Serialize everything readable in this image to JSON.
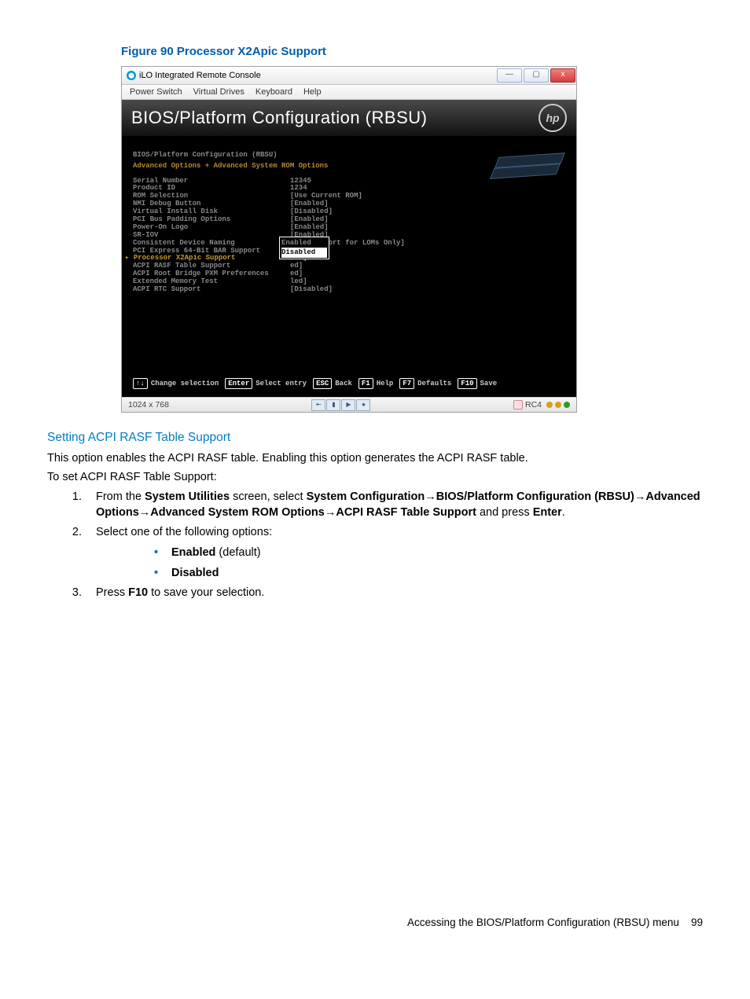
{
  "figure_caption": "Figure 90 Processor X2Apic Support",
  "window": {
    "title": "iLO Integrated Remote Console",
    "menu": [
      "Power Switch",
      "Virtual Drives",
      "Keyboard",
      "Help"
    ],
    "win_min": "—",
    "win_max": "▢",
    "win_close": "x"
  },
  "bios": {
    "heading": "BIOS/Platform Configuration (RBSU)",
    "logo": "hp",
    "breadcrumb1": "BIOS/Platform Configuration (RBSU)",
    "breadcrumb2": "Advanced Options + Advanced System ROM Options",
    "rows": [
      {
        "label": "Serial Number",
        "value": "12345"
      },
      {
        "label": "Product ID",
        "value": "1234"
      },
      {
        "label": "ROM Selection",
        "value": "[Use Current ROM]"
      },
      {
        "label": "NMI Debug Button",
        "value": "[Enabled]"
      },
      {
        "label": "Virtual Install Disk",
        "value": "[Disabled]"
      },
      {
        "label": "PCI Bus Padding Options",
        "value": "[Enabled]"
      },
      {
        "label": "Power-On Logo",
        "value": "[Enabled]"
      },
      {
        "label": "SR-IOV",
        "value": "[Enabled]"
      },
      {
        "label": "Consistent Device Naming",
        "value": "[CDN Support for LOMs Only]"
      },
      {
        "label": "PCI Express 64-Bit BAR Support",
        "value": "[Enabled]"
      },
      {
        "label": "Processor X2Apic Support",
        "value": "led]",
        "current": true
      },
      {
        "label": "ACPI RASF Table Support",
        "value": "ed]"
      },
      {
        "label": "ACPI Root Bridge PXM Preferences",
        "value": "ed]"
      },
      {
        "label": "Extended Memory Test",
        "value": "led]"
      },
      {
        "label": "ACPI RTC Support",
        "value": "[Disabled]"
      }
    ],
    "popup": {
      "opt1": "Enabled",
      "opt2": "Disabled"
    },
    "keys": {
      "updown": "↑↓",
      "updown_lbl": "Change selection",
      "enter": "Enter",
      "enter_lbl": "Select entry",
      "esc": "ESC",
      "esc_lbl": "Back",
      "f1": "F1",
      "f1_lbl": "Help",
      "f7": "F7",
      "f7_lbl": "Defaults",
      "f10": "F10",
      "f10_lbl": "Save"
    }
  },
  "status": {
    "res": "1024 x 768",
    "rc": "RC4"
  },
  "section": {
    "heading": "Setting ACPI RASF Table Support",
    "intro": "This option enables the ACPI RASF table. Enabling this option generates the ACPI RASF table.",
    "lead": "To set ACPI RASF Table Support:",
    "s1a": "From the ",
    "s1b": "System Utilities",
    "s1c": " screen, select ",
    "s1d": "System Configuration",
    "arr": "→",
    "s1e": "BIOS/Platform Configuration (RBSU)",
    "s1f": "Advanced Options",
    "s1g": "Advanced System ROM Options",
    "s1h": "ACPI RASF Table Support",
    "s1i": " and press ",
    "s1j": "Enter",
    "s1k": ".",
    "s2": "Select one of the following options:",
    "opt1a": "Enabled",
    "opt1b": " (default)",
    "opt2": "Disabled",
    "s3a": "Press ",
    "s3b": "F10",
    "s3c": " to save your selection."
  },
  "footer": {
    "text": "Accessing the BIOS/Platform Configuration (RBSU) menu",
    "page": "99"
  }
}
